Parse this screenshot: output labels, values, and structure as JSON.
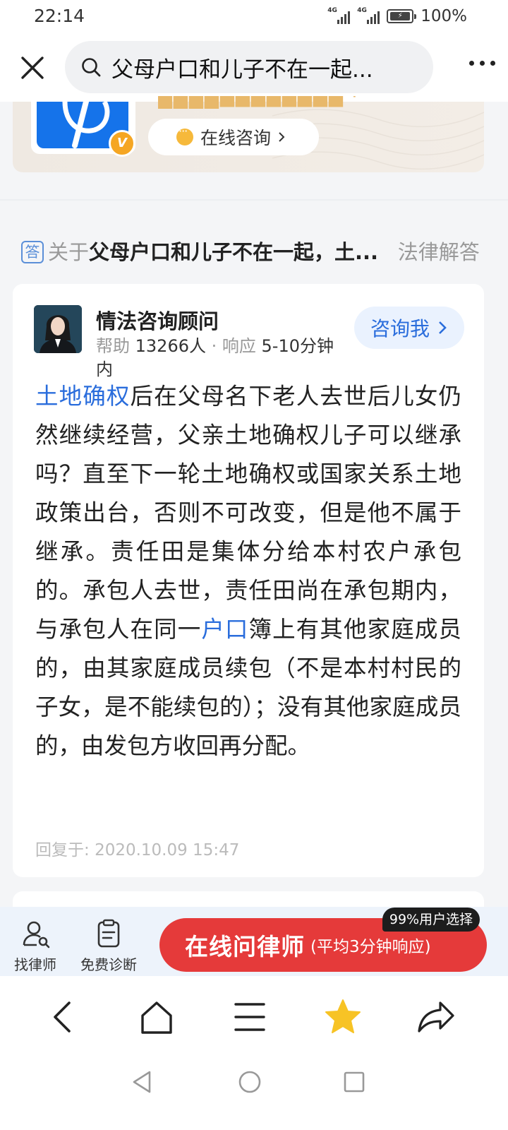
{
  "status": {
    "time": "22:14",
    "network1": "4G",
    "network2": "4G",
    "battery": "100%"
  },
  "search": {
    "query": "父母户口和儿子不在一起..."
  },
  "banner": {
    "consult_label": "在线咨询",
    "verified_mark": "V"
  },
  "question": {
    "badge": "答",
    "prefix": "关于",
    "title": "父母户口和儿子不在一起，土...",
    "suffix": "法律解答"
  },
  "answer": {
    "lawyer_name": "情法咨询顾问",
    "help_label": "帮助",
    "help_count": "13266人",
    "response_label": "响应",
    "response_time": "5-10分钟内",
    "ask_button": "咨询我",
    "body": {
      "link1": "土地确权",
      "part1": "后在父母名下老人去世后儿女仍然继续经营，父亲土地确权儿子可以继承吗？直至下一轮土地确权或国家关系土地政策出台，否则不可改变，但是他不属于继承。责任田是集体分给本村农户承包的。承包人去世，责任田尚在承包期内，与承包人在同一",
      "link2": "户口",
      "part2": "簿上有其他家庭成员的，由其家庭成员续包（不是本村村民的子女，是不能续包的）；没有其他家庭成员的，由发包方收回再分配。"
    },
    "reply_label": "回复于:",
    "reply_time": "2020.10.09 15:47"
  },
  "action_bar": {
    "find_lawyer": "找律师",
    "free_diagnosis": "免费诊断",
    "cta_main": "在线问律师",
    "cta_sub": "(平均3分钟响应)",
    "cta_tag": "99%用户选择"
  },
  "colors": {
    "accent_blue": "#2a6ddc",
    "cta_red": "#e53a3a",
    "star_yellow": "#f7c325"
  }
}
